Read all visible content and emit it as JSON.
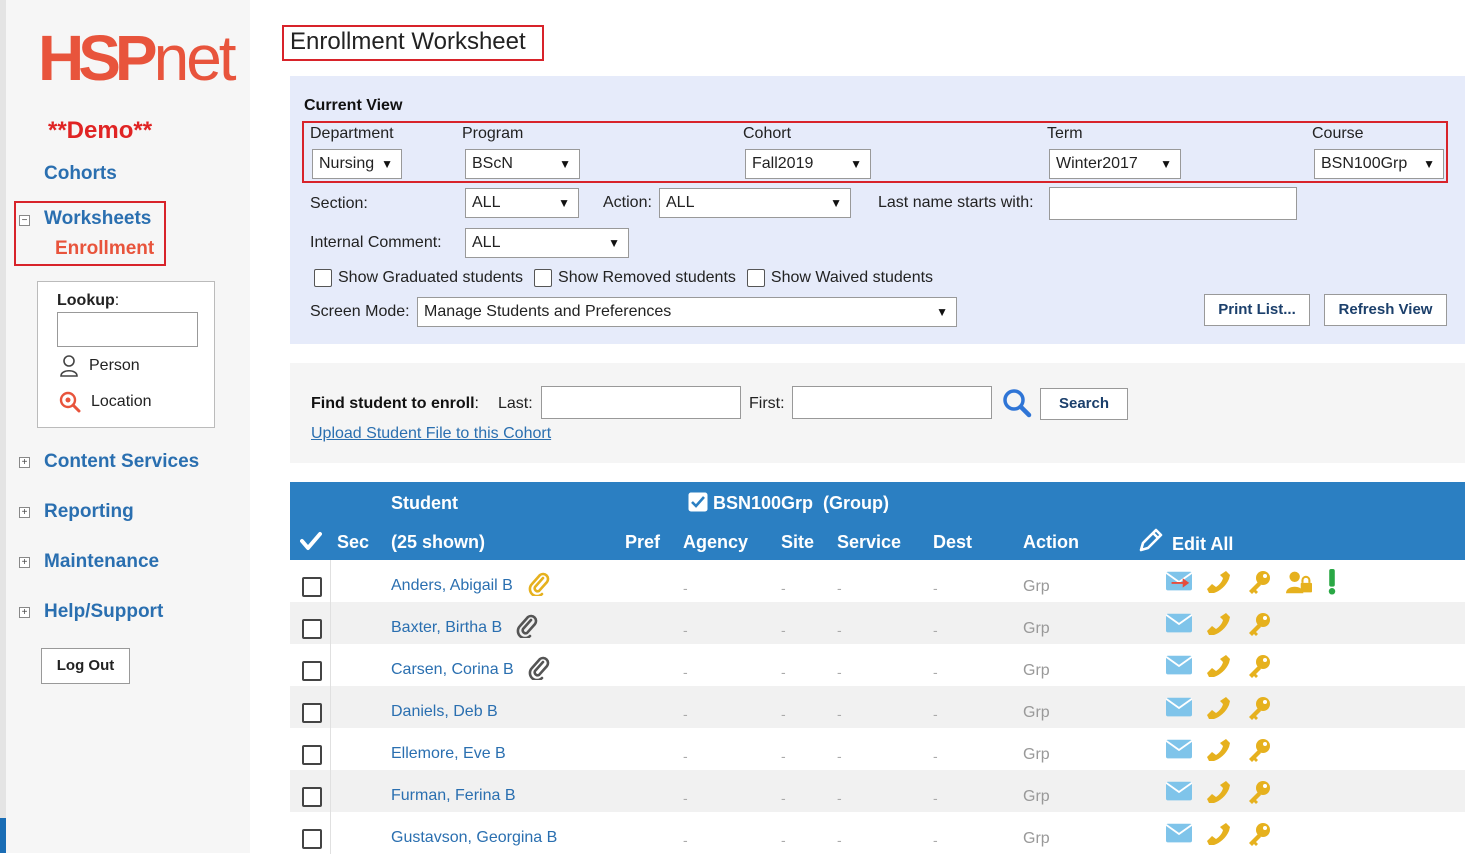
{
  "sidebar": {
    "logo_bold": "HSP",
    "logo_rest": "net",
    "demo_label": "**Demo**",
    "cohorts": "Cohorts",
    "worksheets": "Worksheets",
    "enrollment": "Enrollment",
    "lookup": {
      "label": "Lookup",
      "colon": ":",
      "input_value": "",
      "person": "Person",
      "location": "Location"
    },
    "content_services": "Content Services",
    "reporting": "Reporting",
    "maintenance": "Maintenance",
    "help_support": "Help/Support",
    "logout": "Log Out",
    "toggle_minus": "−",
    "toggle_plus": "+"
  },
  "page": {
    "title": "Enrollment Worksheet"
  },
  "current_view": {
    "title": "Current View",
    "department_label": "Department",
    "department_value": "Nursing",
    "program_label": "Program",
    "program_value": "BScN",
    "cohort_label": "Cohort",
    "cohort_value": "Fall2019",
    "term_label": "Term",
    "term_value": "Winter2017",
    "course_label": "Course",
    "course_value": "BSN100Grp",
    "section_label": "Section:",
    "section_value": "ALL",
    "action_label": "Action:",
    "action_value": "ALL",
    "lastname_label": "Last name starts with:",
    "lastname_value": "",
    "internal_comment_label": "Internal Comment:",
    "internal_comment_value": "ALL",
    "show_graduated": "Show Graduated students",
    "show_removed": "Show Removed students",
    "show_waived": "Show Waived students",
    "screen_mode_label": "Screen Mode:",
    "screen_mode_value": "Manage Students and Preferences",
    "print_list": "Print List...",
    "refresh_view": "Refresh View",
    "arrow": "▼"
  },
  "find": {
    "label": "Find student to enroll",
    "colon": ":",
    "last_label": "Last:",
    "last_value": "",
    "first_label": "First:",
    "first_value": "",
    "search_button": "Search",
    "upload_link": "Upload Student File to this Cohort"
  },
  "table": {
    "headers": {
      "sec": "Sec",
      "student": "Student",
      "shown": "(25 shown)",
      "group": "BSN100Grp  (Group)",
      "pref": "Pref",
      "agency": "Agency",
      "site": "Site",
      "service": "Service",
      "dest": "Dest",
      "action": "Action",
      "edit_all": "Edit All"
    },
    "dash": "-",
    "rows": [
      {
        "name": "Anders, Abigail B",
        "action": "Grp"
      },
      {
        "name": "Baxter, Birtha B",
        "action": "Grp"
      },
      {
        "name": "Carsen, Corina B",
        "action": "Grp"
      },
      {
        "name": "Daniels, Deb B",
        "action": "Grp"
      },
      {
        "name": "Ellemore, Eve B",
        "action": "Grp"
      },
      {
        "name": "Furman, Ferina B",
        "action": "Grp"
      },
      {
        "name": "Gustavson, Georgina B",
        "action": "Grp"
      }
    ]
  },
  "colors": {
    "brand": "#e8543c",
    "link": "#2a6fb0",
    "header_bg": "#2b7fc2",
    "highlight": "#d8232a",
    "icon_gold": "#e6b11e",
    "email_blue": "#7fc4ea",
    "alert_green": "#2aa845"
  }
}
